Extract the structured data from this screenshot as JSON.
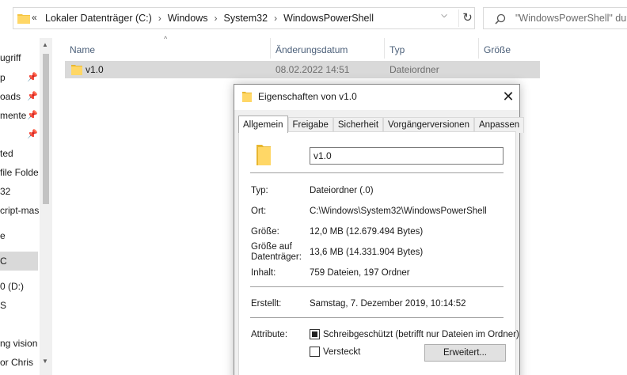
{
  "address": {
    "back_symbol": "«",
    "crumbs": [
      "Lokaler Datenträger (C:)",
      "Windows",
      "System32",
      "WindowsPowerShell"
    ],
    "separator": "›",
    "dropdown_symbol": "⌵",
    "refresh_symbol": "↻",
    "search_placeholder": "\"WindowsPowerShell\" durch..."
  },
  "nav": {
    "items": [
      {
        "label": "ugriff"
      },
      {
        "label": "p"
      },
      {
        "label": "oads"
      },
      {
        "label": "mente"
      },
      {
        "label": ""
      },
      {
        "label": "ted"
      },
      {
        "label": " file Folde"
      },
      {
        "label": "32"
      },
      {
        "label": "cript-mas"
      },
      {
        "label": ""
      },
      {
        "label": "e"
      },
      {
        "label": "C"
      },
      {
        "label": "0 (D:)"
      },
      {
        "label": "S"
      },
      {
        "label": ""
      },
      {
        "label": "ng vision"
      },
      {
        "label": "or Chris"
      }
    ]
  },
  "filelist": {
    "columns": {
      "name": "Name",
      "date": "Änderungsdatum",
      "type": "Typ",
      "size": "Größe"
    },
    "rows": [
      {
        "name": "v1.0",
        "date": "08.02.2022 14:51",
        "type": "Dateiordner"
      }
    ]
  },
  "dialog": {
    "title": "Eigenschaften von v1.0",
    "close_symbol": "✕",
    "tabs": [
      "Allgemein",
      "Freigabe",
      "Sicherheit",
      "Vorgängerversionen",
      "Anpassen"
    ],
    "name_value": "v1.0",
    "props": {
      "type_label": "Typ:",
      "type_value": "Dateiordner (.0)",
      "location_label": "Ort:",
      "location_value": "C:\\Windows\\System32\\WindowsPowerShell",
      "size_label": "Größe:",
      "size_value": "12,0 MB (12.679.494 Bytes)",
      "disk_label_1": "Größe auf",
      "disk_label_2": "Datenträger:",
      "disk_value": "13,6 MB (14.331.904 Bytes)",
      "contents_label": "Inhalt:",
      "contents_value": "759 Dateien, 197 Ordner",
      "created_label": "Erstellt:",
      "created_value": "Samstag, 7. Dezember 2019, 10:14:52",
      "attributes_label": "Attribute:",
      "readonly_label": "Schreibgeschützt (betrifft nur Dateien im Ordner)",
      "hidden_label": "Versteckt",
      "advanced_button": "Erweitert..."
    },
    "readonly_checked": true,
    "hidden_checked": false
  },
  "colors": {
    "folder": "#f5c542",
    "selection": "#d9d9d9",
    "header_text": "#4c607a"
  }
}
